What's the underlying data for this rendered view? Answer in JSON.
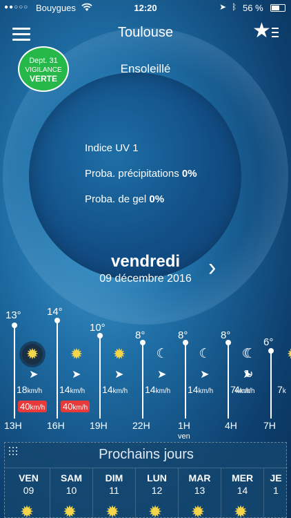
{
  "status": {
    "signal": "●●○○○",
    "carrier": "Bouygues",
    "time": "12:20",
    "battery": "56 %"
  },
  "header": {
    "city": "Toulouse"
  },
  "vigilance": {
    "dept": "Dept. 31",
    "label": "VIGILANCE",
    "level": "VERTE",
    "color": "#27b84a"
  },
  "current": {
    "condition": "Ensoleillé",
    "uv": "Indice UV 1",
    "precip_label": "Proba. précipitations",
    "precip_value": "0%",
    "frost_label": "Proba. de gel",
    "frost_value": "0%"
  },
  "day": {
    "name": "vendredi",
    "date": "09 décembre 2016"
  },
  "hourly": [
    {
      "temp": "13°",
      "wind": "18",
      "unit": "km/h",
      "gust": "40",
      "hour": "13H",
      "icon": "sun-icon"
    },
    {
      "temp": "14°",
      "wind": "14",
      "unit": "km/h",
      "gust": "40",
      "hour": "16H",
      "icon": "sun-icon"
    },
    {
      "temp": "10°",
      "wind": "14",
      "unit": "km/h",
      "hour": "19H",
      "icon": "sun-icon"
    },
    {
      "temp": "8°",
      "wind": "14",
      "unit": "km/h",
      "hour": "22H",
      "icon": "moon-icon"
    },
    {
      "temp": "8°",
      "wind": "14",
      "unit": "km/h",
      "hour": "1H",
      "sub": "ven",
      "icon": "moon-icon"
    },
    {
      "temp": "8°",
      "wind": "7",
      "unit": "km/h",
      "hour": "4H",
      "icon": "moon-icon"
    },
    {
      "temp": "6°",
      "wind": "4",
      "unit": "km/h",
      "hour": "7H",
      "icon": "moon-fog-icon"
    },
    {
      "wind": "7",
      "unit": "k",
      "icon": "sun-icon"
    }
  ],
  "next_days": {
    "title": "Prochains jours",
    "days": [
      {
        "name": "VEN",
        "num": "09"
      },
      {
        "name": "SAM",
        "num": "10"
      },
      {
        "name": "DIM",
        "num": "11"
      },
      {
        "name": "LUN",
        "num": "12"
      },
      {
        "name": "MAR",
        "num": "13"
      },
      {
        "name": "MER",
        "num": "14"
      },
      {
        "name": "JE",
        "num": "1"
      }
    ]
  }
}
